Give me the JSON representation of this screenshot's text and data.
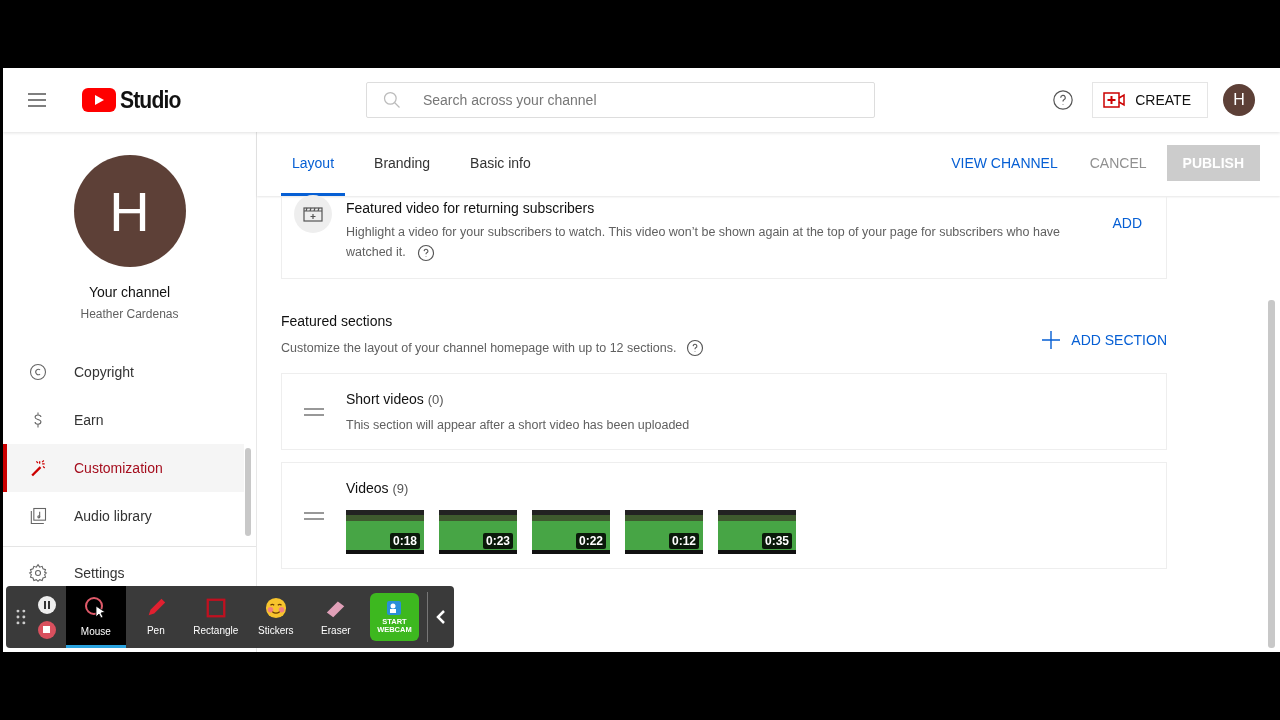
{
  "header": {
    "logo_text": "Studio",
    "search": {
      "placeholder": "Search across your channel"
    },
    "create_label": "CREATE",
    "avatar_letter": "H"
  },
  "sidebar": {
    "avatar_letter": "H",
    "title": "Your channel",
    "subtitle": "Heather Cardenas",
    "items": [
      {
        "label": "Copyright",
        "kind": "copyright",
        "selected": false
      },
      {
        "label": "Earn",
        "kind": "earn",
        "selected": false
      },
      {
        "label": "Customization",
        "kind": "customization",
        "selected": true
      },
      {
        "label": "Audio library",
        "kind": "audio",
        "selected": false
      },
      {
        "label": "Settings",
        "kind": "settings",
        "selected": false
      }
    ]
  },
  "tabs": [
    {
      "label": "Layout",
      "selected": true
    },
    {
      "label": "Branding",
      "selected": false
    },
    {
      "label": "Basic info",
      "selected": false
    }
  ],
  "actions": {
    "view_channel": "VIEW CHANNEL",
    "cancel": "CANCEL",
    "publish": {
      "label": "PUBLISH",
      "disabled": true
    }
  },
  "featured_video": {
    "title": "Featured video for returning subscribers",
    "description": "Highlight a video for your subscribers to watch. This video won’t be shown again at the top of your page for subscribers who have watched it.",
    "action": "ADD"
  },
  "featured_sections": {
    "title": "Featured sections",
    "description": "Customize the layout of your channel homepage with up to 12 sections.",
    "add_label": "ADD SECTION",
    "sections": [
      {
        "title": "Short videos",
        "count": "(0)",
        "description": "This section will appear after a short video has been uploaded"
      },
      {
        "title": "Videos",
        "count": "(9)",
        "videos": [
          {
            "duration": "0:18"
          },
          {
            "duration": "0:23"
          },
          {
            "duration": "0:22"
          },
          {
            "duration": "0:12"
          },
          {
            "duration": "0:35"
          }
        ]
      }
    ]
  },
  "recorder_toolbar": {
    "tools": [
      {
        "label": "Mouse",
        "kind": "mouse",
        "selected": true
      },
      {
        "label": "Pen",
        "kind": "pen",
        "selected": false
      },
      {
        "label": "Rectangle",
        "kind": "rectangle",
        "selected": false
      },
      {
        "label": "Stickers",
        "kind": "stickers",
        "selected": false
      },
      {
        "label": "Eraser",
        "kind": "eraser",
        "selected": false
      }
    ],
    "webcam_label": "START WEBCAM"
  }
}
